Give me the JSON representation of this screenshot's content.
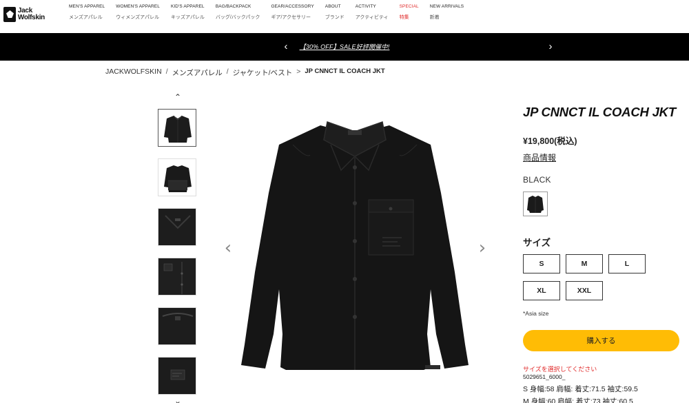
{
  "brand": {
    "name_line1": "Jack",
    "name_line2": "Wolfskin"
  },
  "nav": [
    {
      "en": "MEN'S APPAREL",
      "jp": "メンズアパレル"
    },
    {
      "en": "WOMEN'S APPAREL",
      "jp": "ウィメンズアパレル"
    },
    {
      "en": "KID'S APPAREL",
      "jp": "キッズアパレル"
    },
    {
      "en": "BAG/BACKPACK",
      "jp": "バッグ/バックパック"
    },
    {
      "en": "GEAR/ACCESSORY",
      "jp": "ギア/アクセサリー"
    },
    {
      "en": "ABOUT",
      "jp": "ブランド"
    },
    {
      "en": "ACTIVITY",
      "jp": "アクティビティ"
    },
    {
      "en": "SPECIAL",
      "jp": "特集"
    },
    {
      "en": "NEW ARRIVALS",
      "jp": "新着"
    }
  ],
  "banner": {
    "text": "【30% OFF】SALE好評開催中!",
    "prev_icon": "chevron-left-icon",
    "next_icon": "chevron-right-icon"
  },
  "breadcrumb": {
    "items": [
      "JACKWOLFSKIN",
      "メンズアパレル",
      "ジャケット/ベスト"
    ],
    "current": "JP CNNCT IL COACH JKT",
    "separator": "/",
    "current_marker": ">"
  },
  "gallery": {
    "up_icon": "chevron-up-icon",
    "down_icon": "chevron-down-icon",
    "prev_icon": "chevron-left-icon",
    "next_icon": "chevron-right-icon"
  },
  "product": {
    "title": "JP CNNCT IL COACH JKT",
    "price": "¥19,800(税込)",
    "info_link": "商品情報",
    "color": "BLACK",
    "size_label": "サイズ",
    "sizes": [
      "S",
      "M",
      "L",
      "XL",
      "XXL"
    ],
    "size_note": "*Asia size",
    "buy_label": "購入する",
    "select_size_msg": "サイズを選択してください",
    "sku": "5029651_6000_",
    "dims_s": "S 身幅:58 肩幅: 着丈:71.5 袖丈:59.5",
    "dims_m": "M 身幅:60 肩幅: 着丈:73 袖丈:60.5"
  },
  "colors": {
    "banner_bg": "#000000",
    "buy_button": "#ffbc05",
    "special_nav": "#e02a2a",
    "alert_text": "#e02a2a"
  }
}
